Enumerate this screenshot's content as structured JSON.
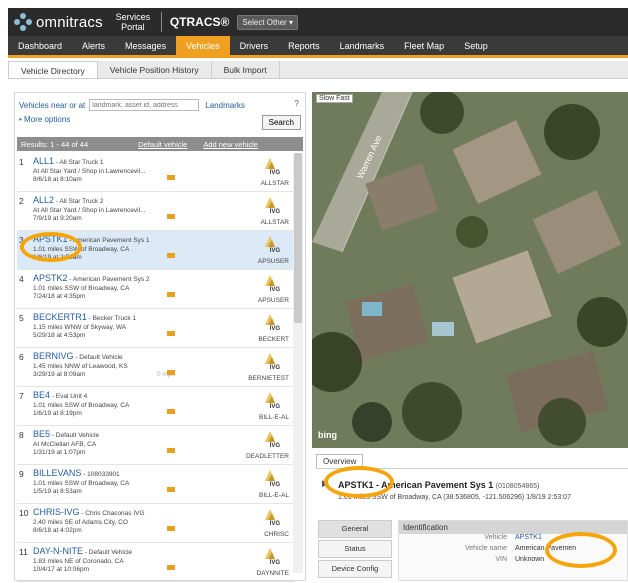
{
  "brand": {
    "logo_text": "omnitracs",
    "services_portal": "Services Portal",
    "product": "QTRACS®",
    "select_other": "Select Other ▾"
  },
  "nav": {
    "items": [
      "Dashboard",
      "Alerts",
      "Messages",
      "Vehicles",
      "Drivers",
      "Reports",
      "Landmarks",
      "Fleet Map",
      "Setup"
    ],
    "active": "Vehicles"
  },
  "subtabs": {
    "items": [
      "Vehicle Directory",
      "Vehicle Position History",
      "Bulk Import"
    ],
    "active": "Vehicle Directory"
  },
  "search": {
    "near_label": "Vehicles near or at",
    "placeholder": "landmark, asset id, address",
    "landmarks": "Landmarks",
    "help": "?",
    "more_options": "• More options",
    "button": "Search"
  },
  "results": {
    "header": "Results: 1 - 44 of 44",
    "default_vehicle": "Default vehicle",
    "add_new_vehicle": "Add new vehicle"
  },
  "vehicles": [
    {
      "num": "1",
      "name": "ALL1",
      "desc": " - All Star Truck 1",
      "loc": "At All Star Yard / Shop in Lawrencevil...",
      "time": "8/6/18 at 8:10am",
      "speed": "",
      "account": "ALLSTAR",
      "selected": false
    },
    {
      "num": "2",
      "name": "ALL2",
      "desc": " - All Star Truck 2",
      "loc": "At All Star Yard / Shop in Lawrencevil...",
      "time": "7/9/19 at 9:20am",
      "speed": "",
      "account": "ALLSTAR",
      "selected": false
    },
    {
      "num": "3",
      "name": "APSTK1",
      "desc": " - American Pavement Sys 1",
      "loc": "1.01 miles SSW of Broadway, CA",
      "time": "1/8/19 at 2:53am",
      "speed": "",
      "account": "APSUSER",
      "selected": true
    },
    {
      "num": "4",
      "name": "APSTK2",
      "desc": " - American Pavement Sys 2",
      "loc": "1.01 miles SSW of Broadway, CA",
      "time": "7/24/18 at 4:35pm",
      "speed": "",
      "account": "APSUSER",
      "selected": false
    },
    {
      "num": "5",
      "name": "BECKERTR1",
      "desc": " - Becker Truck 1",
      "loc": "1.15 miles WNW of Skyway, WA",
      "time": "5/29/18 at 4:53pm",
      "speed": "",
      "account": "BECKERT",
      "selected": false
    },
    {
      "num": "6",
      "name": "BERNIVG",
      "desc": " - Default Vehicle",
      "loc": "1.45 miles NNW of Leawood, KS",
      "time": "3/29/19 at 8:09am",
      "speed": "0 mph",
      "account": "BERNIETEST",
      "selected": false
    },
    {
      "num": "7",
      "name": "BE4",
      "desc": " - Eval Unit 4",
      "loc": "1.01 miles SSW of Broadway, CA",
      "time": "1/6/19 at 8:19pm",
      "speed": "",
      "account": "BILL-E-AL",
      "selected": false
    },
    {
      "num": "8",
      "name": "BE5",
      "desc": " - Default Vehicle",
      "loc": "At McClellan AFB, CA",
      "time": "1/31/19 at 1:07pm",
      "speed": "",
      "account": "DEADLETTER",
      "selected": false
    },
    {
      "num": "9",
      "name": "BILLEVANS",
      "desc": " - 108033901",
      "loc": "1.01 miles SSW of Broadway, CA",
      "time": "1/5/19 at 8:53am",
      "speed": "",
      "account": "BILL-E-AL",
      "selected": false
    },
    {
      "num": "10",
      "name": "CHRIS-IVG",
      "desc": " - Chris Chaconas IVG",
      "loc": "2.40 miles SE of Adams City, CO",
      "time": "8/6/18 at 4:02pm",
      "speed": "",
      "account": "CHRISC",
      "selected": false
    },
    {
      "num": "11",
      "name": "DAY-N-NITE",
      "desc": " - Default Vehicle",
      "loc": "1.83 miles NE of Coronado, CA",
      "time": "10/4/17 at 10:06pm",
      "speed": "",
      "account": "DAYNNITE",
      "selected": false
    }
  ],
  "ivg_label": "IVG",
  "map": {
    "speed_label": "Slow  Fast",
    "street": "Warren Ave",
    "provider": "bing"
  },
  "detail": {
    "tab": "Overview",
    "vehicle_name": "APSTK1 - American Pavement Sys 1",
    "vehicle_id": "(0108054865)",
    "location": "1.01 miles SSW of Broadway, CA  (38.536805, -121.506296)  1/8/19 2:53:07",
    "side_buttons": [
      "General",
      "Status",
      "Device Config"
    ],
    "ident_header": "Identification",
    "fields": [
      {
        "k": "Vehicle",
        "v": "APSTK1"
      },
      {
        "k": "Vehicle name",
        "v": "American Pavemen"
      },
      {
        "k": "VIN",
        "v": "Unknown"
      }
    ]
  }
}
